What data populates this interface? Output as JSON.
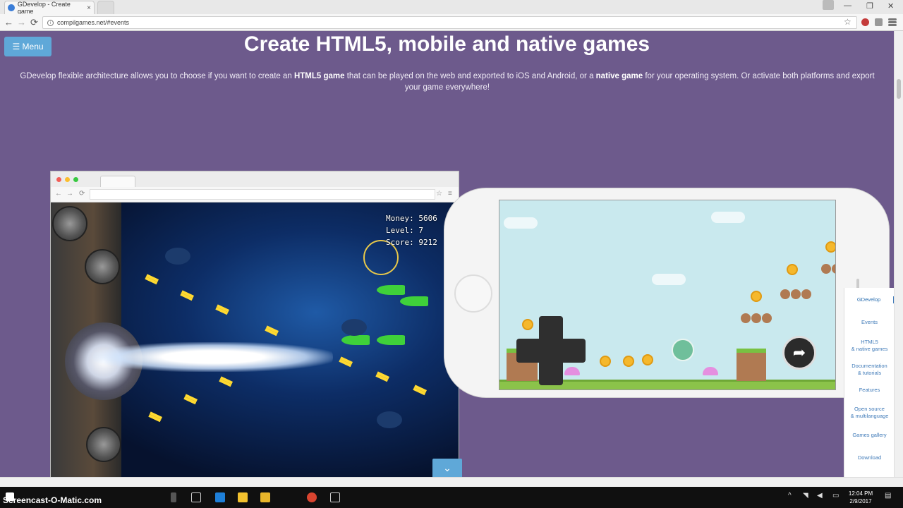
{
  "browser": {
    "tab_title": "GDevelop - Create game",
    "tab_close": "×",
    "url": "compilgames.net/#events",
    "back": "←",
    "forward": "→",
    "reload": "⟳",
    "star": "☆",
    "win_minimize": "—",
    "win_maximize": "❐",
    "win_close": "✕"
  },
  "page": {
    "menu_label": "☰ Menu",
    "headline": "Create HTML5, mobile and native games",
    "desc_part1": "GDevelop flexible architecture allows you to choose if you want to create an ",
    "desc_bold1": "HTML5 game",
    "desc_part2": " that can be played on the web and exported to iOS and Android, or a ",
    "desc_bold2": "native game",
    "desc_part3": " for your operating system. Or activate both platforms and export your game everywhere!",
    "scroll_down": "⌄"
  },
  "game_hud": {
    "money": "Money: 5606",
    "level": "Level: 7",
    "score": "Score: 9212"
  },
  "jump_glyph": "➦",
  "sidenav": {
    "items": [
      {
        "line1": "GDevelop",
        "line2": ""
      },
      {
        "line1": "Events",
        "line2": ""
      },
      {
        "line1": "HTML5",
        "line2": "& native games"
      },
      {
        "line1": "Documentation",
        "line2": "& tutorials"
      },
      {
        "line1": "Features",
        "line2": ""
      },
      {
        "line1": "Open source",
        "line2": "& multilanguage"
      },
      {
        "line1": "Games gallery",
        "line2": ""
      },
      {
        "line1": "Download",
        "line2": ""
      }
    ],
    "active_index": 0
  },
  "taskbar": {
    "watermark": "Screencast-O-Matic.com",
    "time": "12:04 PM",
    "date": "2/9/2017"
  },
  "colors": {
    "page_bg": "#6d5a8c",
    "accent": "#5fa8d8",
    "nav_link": "#3f7ab8"
  }
}
